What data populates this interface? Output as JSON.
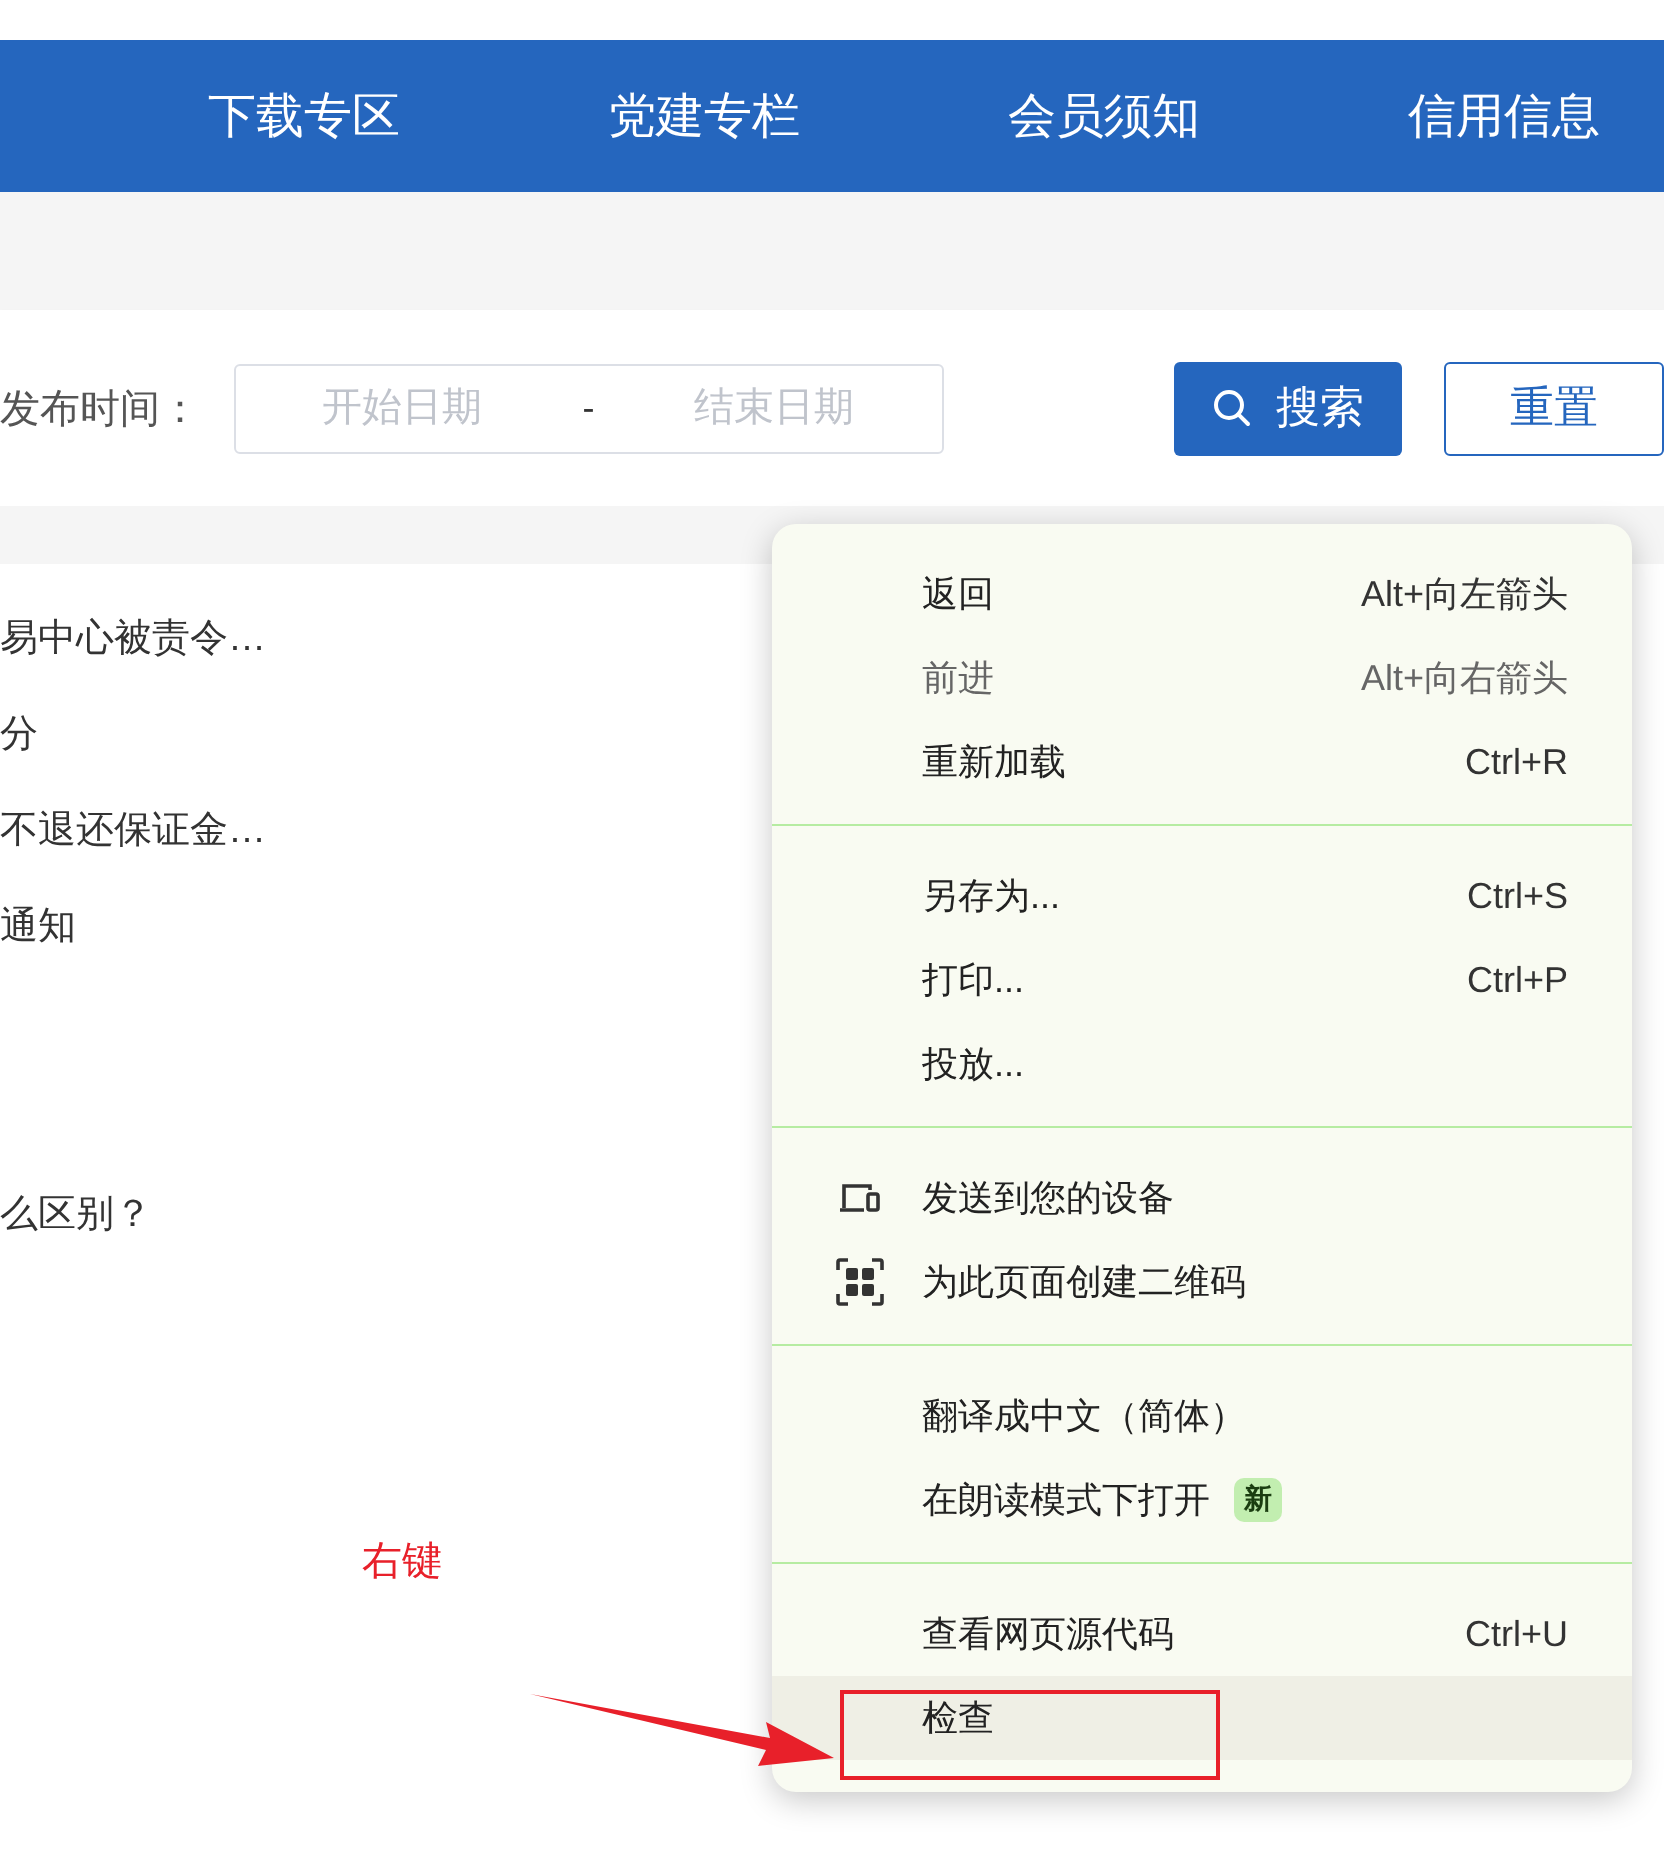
{
  "nav": {
    "items": [
      "下载专区",
      "党建专栏",
      "会员须知",
      "信用信息"
    ]
  },
  "filter": {
    "label": "发布时间：",
    "start_placeholder": "开始日期",
    "separator": "-",
    "end_placeholder": "结束日期",
    "search_button": "搜索",
    "reset_button": "重置"
  },
  "articles": [
    "易中心被责令…",
    "分",
    "不退还保证金…",
    "通知",
    "么区别？"
  ],
  "context_menu": {
    "sections": [
      {
        "items": [
          {
            "label": "返回",
            "shortcut": "Alt+向左箭头",
            "disabled": false,
            "highlighted": false
          },
          {
            "label": "前进",
            "shortcut": "Alt+向右箭头",
            "disabled": true,
            "highlighted": false
          },
          {
            "label": "重新加载",
            "shortcut": "Ctrl+R",
            "disabled": false,
            "highlighted": false
          }
        ]
      },
      {
        "items": [
          {
            "label": "另存为...",
            "shortcut": "Ctrl+S",
            "disabled": false,
            "highlighted": false
          },
          {
            "label": "打印...",
            "shortcut": "Ctrl+P",
            "disabled": false,
            "highlighted": false
          },
          {
            "label": "投放...",
            "disabled": false,
            "highlighted": false
          }
        ]
      },
      {
        "items": [
          {
            "label": "发送到您的设备",
            "kind": "devices",
            "disabled": false,
            "highlighted": false
          },
          {
            "label": "为此页面创建二维码",
            "kind": "qr",
            "disabled": false,
            "highlighted": false
          }
        ]
      },
      {
        "items": [
          {
            "label": "翻译成中文（简体）",
            "disabled": false,
            "highlighted": false
          },
          {
            "label": "在朗读模式下打开",
            "badge": "新",
            "disabled": false,
            "highlighted": false
          }
        ]
      },
      {
        "items": [
          {
            "label": "查看网页源代码",
            "shortcut": "Ctrl+U",
            "disabled": false,
            "highlighted": false
          },
          {
            "label": "检查",
            "disabled": false,
            "highlighted": true
          }
        ]
      }
    ]
  },
  "annotation": {
    "label": "右键"
  }
}
